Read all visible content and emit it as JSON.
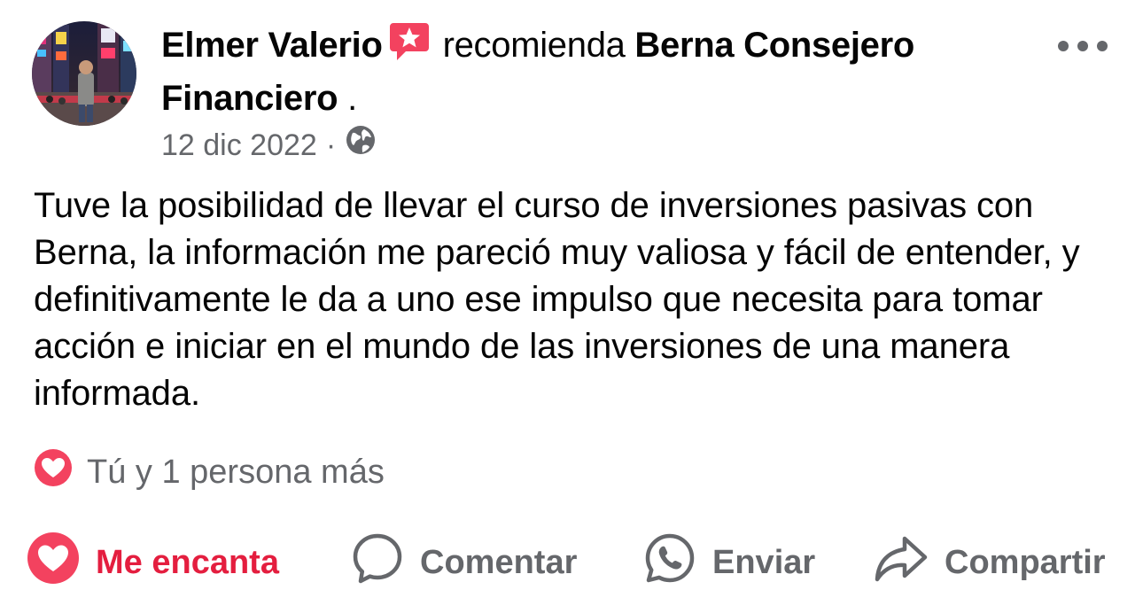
{
  "post": {
    "author": "Elmer Valerio",
    "verb": "recomienda",
    "page_name": "Berna Consejero Financiero",
    "trailing": " .",
    "date": "12 dic 2022",
    "separator": "·",
    "audience_icon": "globe-icon",
    "body": "Tuve la posibilidad de llevar el curso de inversiones pasivas con Berna, la información me pareció muy valiosa y fácil de entender, y definitivamente le da a uno ese impulso que necesita para tomar acción e iniciar en el mundo de las inversiones de una manera informada."
  },
  "reactions": {
    "icon": "love-reaction-icon",
    "summary": "Tú y 1 persona más"
  },
  "actions": {
    "love_label": "Me encanta",
    "comment_label": "Comentar",
    "send_label": "Enviar",
    "share_label": "Compartir"
  },
  "colors": {
    "love": "#e41e3f",
    "recommend_badge": "#f3425f",
    "muted": "#65676b",
    "text": "#050505"
  }
}
